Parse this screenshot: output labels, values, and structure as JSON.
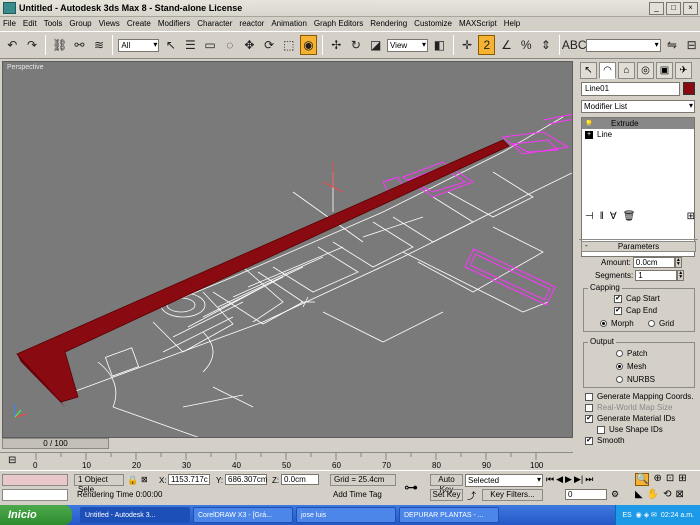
{
  "window": {
    "title": "Untitled - Autodesk 3ds Max 8  - Stand-alone License"
  },
  "menu": [
    "File",
    "Edit",
    "Tools",
    "Group",
    "Views",
    "Create",
    "Modifiers",
    "Character",
    "reactor",
    "Animation",
    "Graph Editors",
    "Rendering",
    "Customize",
    "MAXScript",
    "Help"
  ],
  "toolbar": {
    "selection_filter": "All",
    "ref_coord": "View",
    "named_sel": ""
  },
  "viewport": {
    "label": "Perspective",
    "object_color": "#8a0a12",
    "spline_color": "#ff33ff",
    "bg": "#7a7a7a"
  },
  "command_panel": {
    "object_name": "Line01",
    "modifier_list": "Modifier List",
    "stack": [
      {
        "label": "Extrude",
        "selected": true
      },
      {
        "label": "Line",
        "selected": false
      }
    ],
    "parameters": {
      "title": "Parameters",
      "amount_label": "Amount:",
      "amount": "0.0cm",
      "segments_label": "Segments:",
      "segments": "1",
      "capping_label": "Capping",
      "cap_start": "Cap Start",
      "cap_end": "Cap End",
      "morph": "Morph",
      "grid": "Grid",
      "output_label": "Output",
      "patch": "Patch",
      "mesh": "Mesh",
      "nurbs": "NURBS",
      "gen_map": "Generate Mapping Coords.",
      "real_world": "Real-World Map Size",
      "gen_mat": "Generate Material IDs",
      "use_shape": "Use Shape IDs",
      "smooth": "Smooth"
    }
  },
  "timeline": {
    "frame": "0 / 100",
    "ticks": [
      "0",
      "10",
      "20",
      "30",
      "40",
      "50",
      "60",
      "70",
      "80",
      "90",
      "100"
    ]
  },
  "status": {
    "selected": "1 Object Sele",
    "x_label": "X:",
    "x": "1153.717c",
    "y_label": "Y:",
    "y": "686.307cm",
    "z_label": "Z:",
    "z": "0.0cm",
    "grid": "Grid = 25.4cm",
    "render_time": "Rendering Time  0:00:00",
    "add_time_tag": "Add Time Tag",
    "auto_key": "Auto Key",
    "set_key": "Set Key",
    "key_mode": "Selected",
    "key_filters": "Key Filters...",
    "current_frame": "0"
  },
  "taskbar": {
    "start": "Inicio",
    "items": [
      "Untitled - Autodesk 3...",
      "CorelDRAW X3 - [Grá...",
      "jose luis",
      "DEPURAR PLANTAS - ..."
    ],
    "lang": "ES",
    "time": "02:24 a.m."
  }
}
